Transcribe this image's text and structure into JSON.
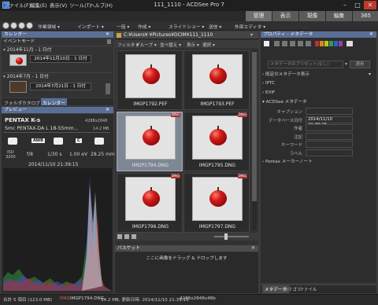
{
  "window": {
    "title": "111_1110 - ACDSee Pro 7",
    "min": "–",
    "max": "□",
    "close": "✕"
  },
  "menu": [
    "ファイル(F)",
    "編集(E)",
    "表示(V)",
    "ツール(T)",
    "ヘルプ(H)"
  ],
  "modes": [
    {
      "label": "管理",
      "active": true
    },
    {
      "label": "表示",
      "active": false
    },
    {
      "label": "現像",
      "active": false
    },
    {
      "label": "編集",
      "active": false
    },
    {
      "label": "365",
      "active": false
    }
  ],
  "toolbar": [
    "作業領域 ▾",
    "インポート ▾",
    "一括 ▾",
    "作成 ▾",
    "スライドショー ▾",
    "送信 ▾",
    "外部エディタ ▾"
  ],
  "calendar": {
    "title": "カレンダー",
    "event_mode": "イベントモード",
    "groups": [
      {
        "header": "2014年11月 - 1 日付",
        "date_label": "2014年11月10日 - 1 日付"
      },
      {
        "header": "2014年7月 - 1 日付",
        "date_label": "2014年7月21日 - 1 日付"
      }
    ],
    "tabs": [
      "フォルダ",
      "カタログ",
      "カレンダー"
    ]
  },
  "preview": {
    "title": "プレビュー",
    "camera": "PENTAX K-s",
    "dimensions": "4288x2848",
    "lens": "Smc PENTAX-DA L 18-55mm...",
    "filesize": "14.2 MB",
    "mode_labels": [
      "AWB",
      "C"
    ],
    "iso_label": "ISO",
    "iso_value": "3200",
    "aperture": "f/8",
    "shutter": "1/30 s",
    "ev": "1.00 eV",
    "focal": "28.25 mm",
    "timestamp": "2014/11/10 21:39:15"
  },
  "browser": {
    "path": "C:¥Users¥          ¥Pictures¥DCIM¥111_1110",
    "filters": [
      "フィルタ ▾",
      "グループ ▾",
      "並べ替え ▾",
      "表示 ▾",
      "選択 ▾"
    ],
    "items": [
      {
        "name": "IMGP1792.PEF",
        "badge": "",
        "selected": false
      },
      {
        "name": "IMGP1793.PEF",
        "badge": "",
        "selected": false
      },
      {
        "name": "IMGP1794.DNG",
        "badge": "DNG",
        "selected": true
      },
      {
        "name": "IMGP1795.DNG",
        "badge": "DNG",
        "selected": false
      },
      {
        "name": "IMGP1796.DNG",
        "badge": "DNG",
        "selected": false
      },
      {
        "name": "IMGP1797.DNG",
        "badge": "DNG",
        "selected": false
      }
    ],
    "zoom": 0.33
  },
  "basket": {
    "title": "バスケット",
    "hint": "ここに画像をドラッグ & ドロップします"
  },
  "properties": {
    "title": "プロパティ - メタデータ",
    "preset_placeholder": "メタデータのプリセット(なし)",
    "apply": "適用",
    "sections": [
      "既定のメタデータ表示",
      "IPTC",
      "EXIF",
      "ACDSee メタデータ"
    ],
    "fields": [
      {
        "label": "キャプション",
        "value": ""
      },
      {
        "label": "データベース日付",
        "value": "2014/11/10 21:39:15"
      },
      {
        "label": "作者",
        "value": ""
      },
      {
        "label": "注記",
        "value": ""
      },
      {
        "label": "キーワード",
        "value": ""
      },
      {
        "label": "ラベル",
        "value": ""
      }
    ],
    "pentax_note": "Pentax メーカーノート",
    "bottom_tabs": [
      "メタデータ",
      "カテゴリ",
      "ファイル"
    ]
  },
  "status": {
    "total": "合計 5 項目 (123.0 MB)",
    "type": "DNG",
    "file": "IMGP1794.DNG",
    "size": "14.2 MB, 更新日時: 2014/11/10 21:39:15",
    "dims": "4288x2848x48b"
  },
  "colors": {
    "accent": "#5a6f96",
    "selected": "#7e8895",
    "apple": "#c81818"
  }
}
